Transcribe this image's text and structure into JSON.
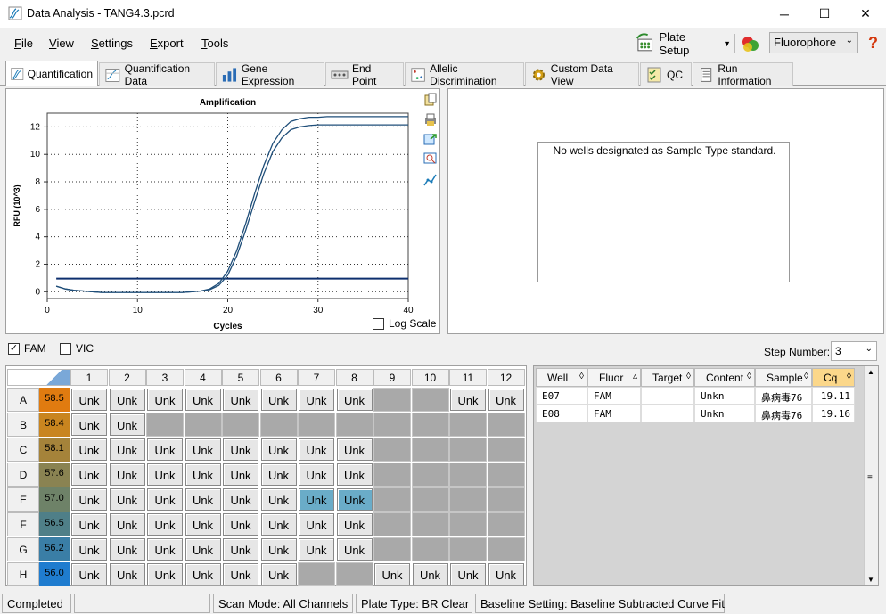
{
  "window": {
    "title": "Data Analysis - TANG4.3.pcrd",
    "minimize": "─",
    "maximize": "☐",
    "close": "✕"
  },
  "menu": [
    {
      "label": "File"
    },
    {
      "label": "View"
    },
    {
      "label": "Settings"
    },
    {
      "label": "Export"
    },
    {
      "label": "Tools"
    }
  ],
  "toolbar": {
    "plate_setup": "Plate Setup",
    "fluorophore": "Fluorophore",
    "help": "?"
  },
  "tabs": [
    "Quantification",
    "Quantification Data",
    "Gene Expression",
    "End Point",
    "Allelic Discrimination",
    "Custom Data View",
    "QC",
    "Run Information"
  ],
  "standard_message": "No wells designated as Sample Type standard.",
  "log_scale_label": "Log Scale",
  "fluor_checks": [
    {
      "label": "FAM",
      "checked": true
    },
    {
      "label": "VIC",
      "checked": false
    }
  ],
  "step_number": {
    "label": "Step Number:",
    "value": "3"
  },
  "chart_data": {
    "type": "line",
    "title": "Amplification",
    "xlabel": "Cycles",
    "ylabel": "RFU (10^3)",
    "xlim": [
      0,
      40
    ],
    "ylim": [
      -0.5,
      13
    ],
    "x_ticks": [
      0,
      10,
      20,
      30,
      40
    ],
    "y_ticks": [
      0,
      2,
      4,
      6,
      8,
      10,
      12
    ],
    "grid": true,
    "series": [
      {
        "x": [
          1,
          2,
          3,
          4,
          5,
          6,
          7,
          8,
          9,
          10,
          11,
          12,
          13,
          14,
          15,
          16,
          17,
          18,
          19,
          20,
          21,
          22,
          23,
          24,
          25,
          26,
          27,
          28,
          29,
          30,
          31,
          32,
          33,
          34,
          35,
          36,
          37,
          38,
          39,
          40
        ],
        "values": [
          0.4,
          0.2,
          0.1,
          0.05,
          0,
          -0.05,
          -0.05,
          -0.05,
          -0.05,
          -0.05,
          -0.05,
          -0.05,
          -0.05,
          -0.05,
          -0.05,
          0,
          0.05,
          0.2,
          0.6,
          1.5,
          3.0,
          5.0,
          7.2,
          9.2,
          10.8,
          11.8,
          12.4,
          12.6,
          12.7,
          12.7,
          12.75,
          12.75,
          12.75,
          12.75,
          12.75,
          12.75,
          12.75,
          12.75,
          12.75,
          12.75
        ]
      },
      {
        "x": [
          1,
          2,
          3,
          4,
          5,
          6,
          7,
          8,
          9,
          10,
          11,
          12,
          13,
          14,
          15,
          16,
          17,
          18,
          19,
          20,
          21,
          22,
          23,
          24,
          25,
          26,
          27,
          28,
          29,
          30,
          31,
          32,
          33,
          34,
          35,
          36,
          37,
          38,
          39,
          40
        ],
        "values": [
          0.4,
          0.2,
          0.1,
          0.05,
          0,
          -0.05,
          -0.05,
          -0.05,
          -0.05,
          -0.05,
          -0.05,
          -0.05,
          -0.05,
          -0.05,
          -0.05,
          0,
          0.05,
          0.15,
          0.45,
          1.2,
          2.6,
          4.5,
          6.6,
          8.6,
          10.2,
          11.2,
          11.8,
          12.0,
          12.1,
          12.15,
          12.15,
          12.15,
          12.15,
          12.15,
          12.15,
          12.15,
          12.15,
          12.15,
          12.15,
          12.15
        ]
      }
    ],
    "threshold": 0.95,
    "colors": {
      "curve": "#1f4e79",
      "threshold": "#0d2f6e"
    }
  },
  "plate": {
    "columns": [
      "1",
      "2",
      "3",
      "4",
      "5",
      "6",
      "7",
      "8",
      "9",
      "10",
      "11",
      "12"
    ],
    "rows": [
      {
        "label": "A",
        "temp": "58.5",
        "temp_color": "#e07b10",
        "wells": [
          "Unk",
          "Unk",
          "Unk",
          "Unk",
          "Unk",
          "Unk",
          "Unk",
          "Unk",
          "",
          "",
          "Unk",
          "Unk"
        ]
      },
      {
        "label": "B",
        "temp": "58.4",
        "temp_color": "#c9851f",
        "wells": [
          "Unk",
          "Unk",
          "",
          "",
          "",
          "",
          "",
          "",
          "",
          "",
          "",
          ""
        ]
      },
      {
        "label": "C",
        "temp": "58.1",
        "temp_color": "#a5833a",
        "wells": [
          "Unk",
          "Unk",
          "Unk",
          "Unk",
          "Unk",
          "Unk",
          "Unk",
          "Unk",
          "",
          "",
          "",
          ""
        ]
      },
      {
        "label": "D",
        "temp": "57.6",
        "temp_color": "#8a8352",
        "wells": [
          "Unk",
          "Unk",
          "Unk",
          "Unk",
          "Unk",
          "Unk",
          "Unk",
          "Unk",
          "",
          "",
          "",
          ""
        ]
      },
      {
        "label": "E",
        "temp": "57.0",
        "temp_color": "#6e8268",
        "wells": [
          "Unk",
          "Unk",
          "Unk",
          "Unk",
          "Unk",
          "Unk",
          "Unk",
          "Unk",
          "",
          "",
          "",
          ""
        ],
        "highlight": [
          6,
          7
        ]
      },
      {
        "label": "F",
        "temp": "56.5",
        "temp_color": "#4f7f88",
        "wells": [
          "Unk",
          "Unk",
          "Unk",
          "Unk",
          "Unk",
          "Unk",
          "Unk",
          "Unk",
          "",
          "",
          "",
          ""
        ]
      },
      {
        "label": "G",
        "temp": "56.2",
        "temp_color": "#3a7ea6",
        "wells": [
          "Unk",
          "Unk",
          "Unk",
          "Unk",
          "Unk",
          "Unk",
          "Unk",
          "Unk",
          "",
          "",
          "",
          ""
        ]
      },
      {
        "label": "H",
        "temp": "56.0",
        "temp_color": "#1f7ccf",
        "wells": [
          "Unk",
          "Unk",
          "Unk",
          "Unk",
          "Unk",
          "Unk",
          "",
          "",
          "Unk",
          "Unk",
          "Unk",
          "Unk"
        ]
      }
    ]
  },
  "data_table": {
    "headers": [
      "Well",
      "Fluor",
      "Target",
      "Content",
      "Sample",
      "Cq"
    ],
    "rows": [
      [
        "E07",
        "FAM",
        "",
        "Unkn",
        "鼻病毒76",
        "19.11"
      ],
      [
        "E08",
        "FAM",
        "",
        "Unkn",
        "鼻病毒76",
        "19.16"
      ]
    ]
  },
  "status": {
    "state": "Completed",
    "scan_mode": "Scan Mode: All Channels",
    "plate_type": "Plate Type: BR Clear",
    "baseline": "Baseline Setting: Baseline Subtracted Curve Fit"
  }
}
